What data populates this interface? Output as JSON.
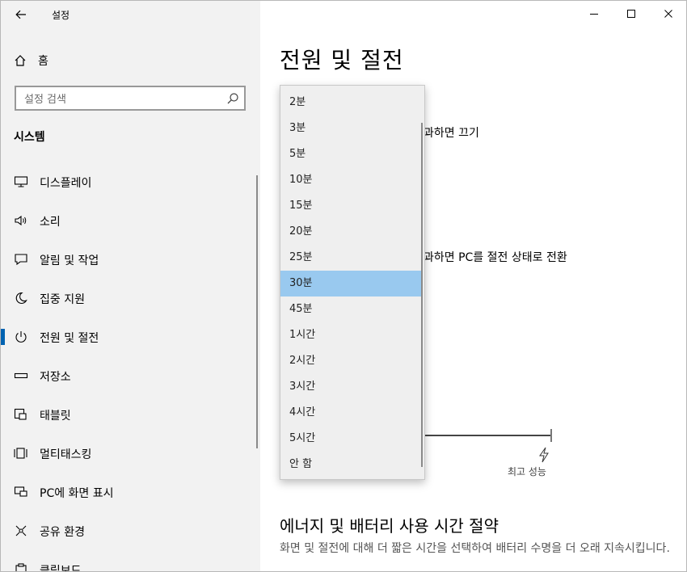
{
  "window": {
    "app_title": "설정",
    "controls": [
      "minimize",
      "maximize",
      "close"
    ]
  },
  "sidebar": {
    "home_label": "홈",
    "search_placeholder": "설정 검색",
    "section_title": "시스템",
    "items": [
      {
        "label": "디스플레이",
        "icon": "monitor-icon"
      },
      {
        "label": "소리",
        "icon": "speaker-icon"
      },
      {
        "label": "알림 및 작업",
        "icon": "notification-icon"
      },
      {
        "label": "집중 지원",
        "icon": "moon-icon"
      },
      {
        "label": "전원 및 절전",
        "icon": "power-icon",
        "selected": true
      },
      {
        "label": "저장소",
        "icon": "storage-icon"
      },
      {
        "label": "태블릿",
        "icon": "tablet-icon"
      },
      {
        "label": "멀티태스킹",
        "icon": "multitask-icon"
      },
      {
        "label": "PC에 화면 표시",
        "icon": "project-icon"
      },
      {
        "label": "공유 환경",
        "icon": "shared-icon"
      },
      {
        "label": "클립보드",
        "icon": "clipboard-icon"
      }
    ]
  },
  "main": {
    "page_title": "전원 및 절전",
    "screen_text_partial": "과하면 끄기",
    "sleep_text_partial": "과하면 PC를 절전 상태로 전환",
    "performance_label": "최고 성능",
    "section2_title": "에너지 및 배터리 사용 시간 절약",
    "section2_desc": "화면 및 절전에 대해 더 짧은 시간을 선택하여 배터리 수명을 더 오래 지속시킵니다."
  },
  "dropdown": {
    "options": [
      "2분",
      "3분",
      "5분",
      "10분",
      "15분",
      "20분",
      "25분",
      "30분",
      "45분",
      "1시간",
      "2시간",
      "3시간",
      "4시간",
      "5시간",
      "안 함"
    ],
    "selected": "30분"
  }
}
